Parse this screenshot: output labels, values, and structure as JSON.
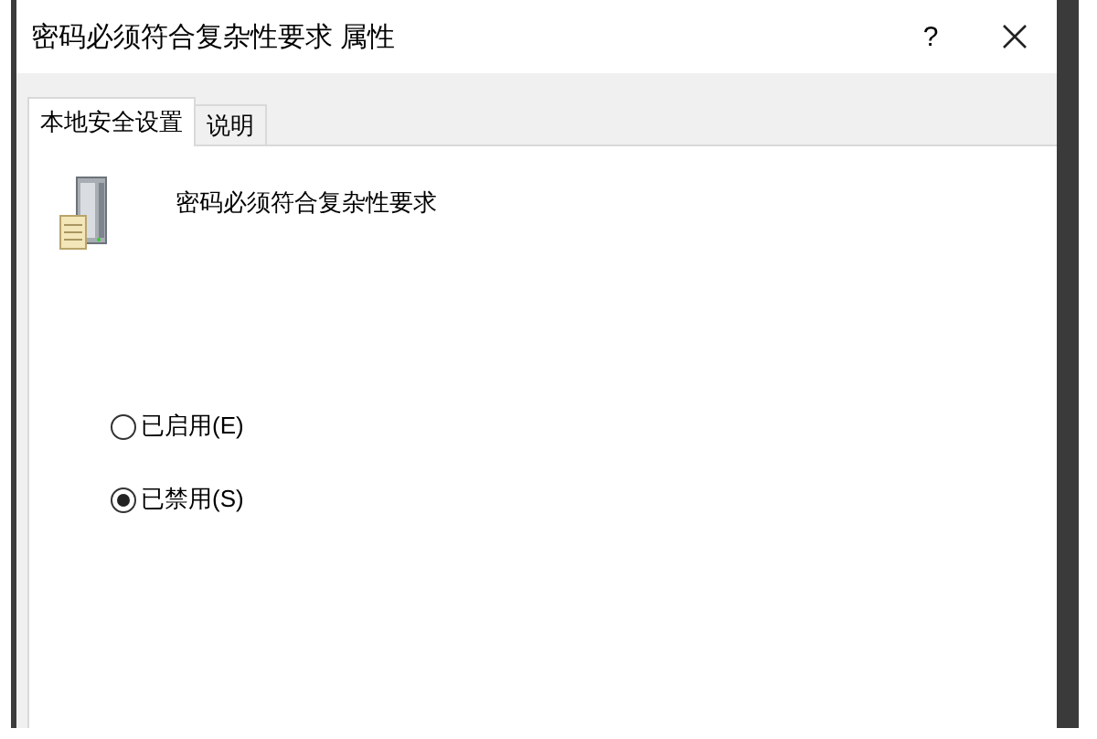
{
  "window": {
    "title": "密码必须符合复杂性要求 属性",
    "help": "?"
  },
  "tabs": [
    {
      "label": "本地安全设置",
      "selected": true
    },
    {
      "label": "说明",
      "selected": false
    }
  ],
  "policy": {
    "name": "密码必须符合复杂性要求"
  },
  "options": [
    {
      "label": "已启用(E)",
      "selected": false
    },
    {
      "label": "已禁用(S)",
      "selected": true
    }
  ]
}
